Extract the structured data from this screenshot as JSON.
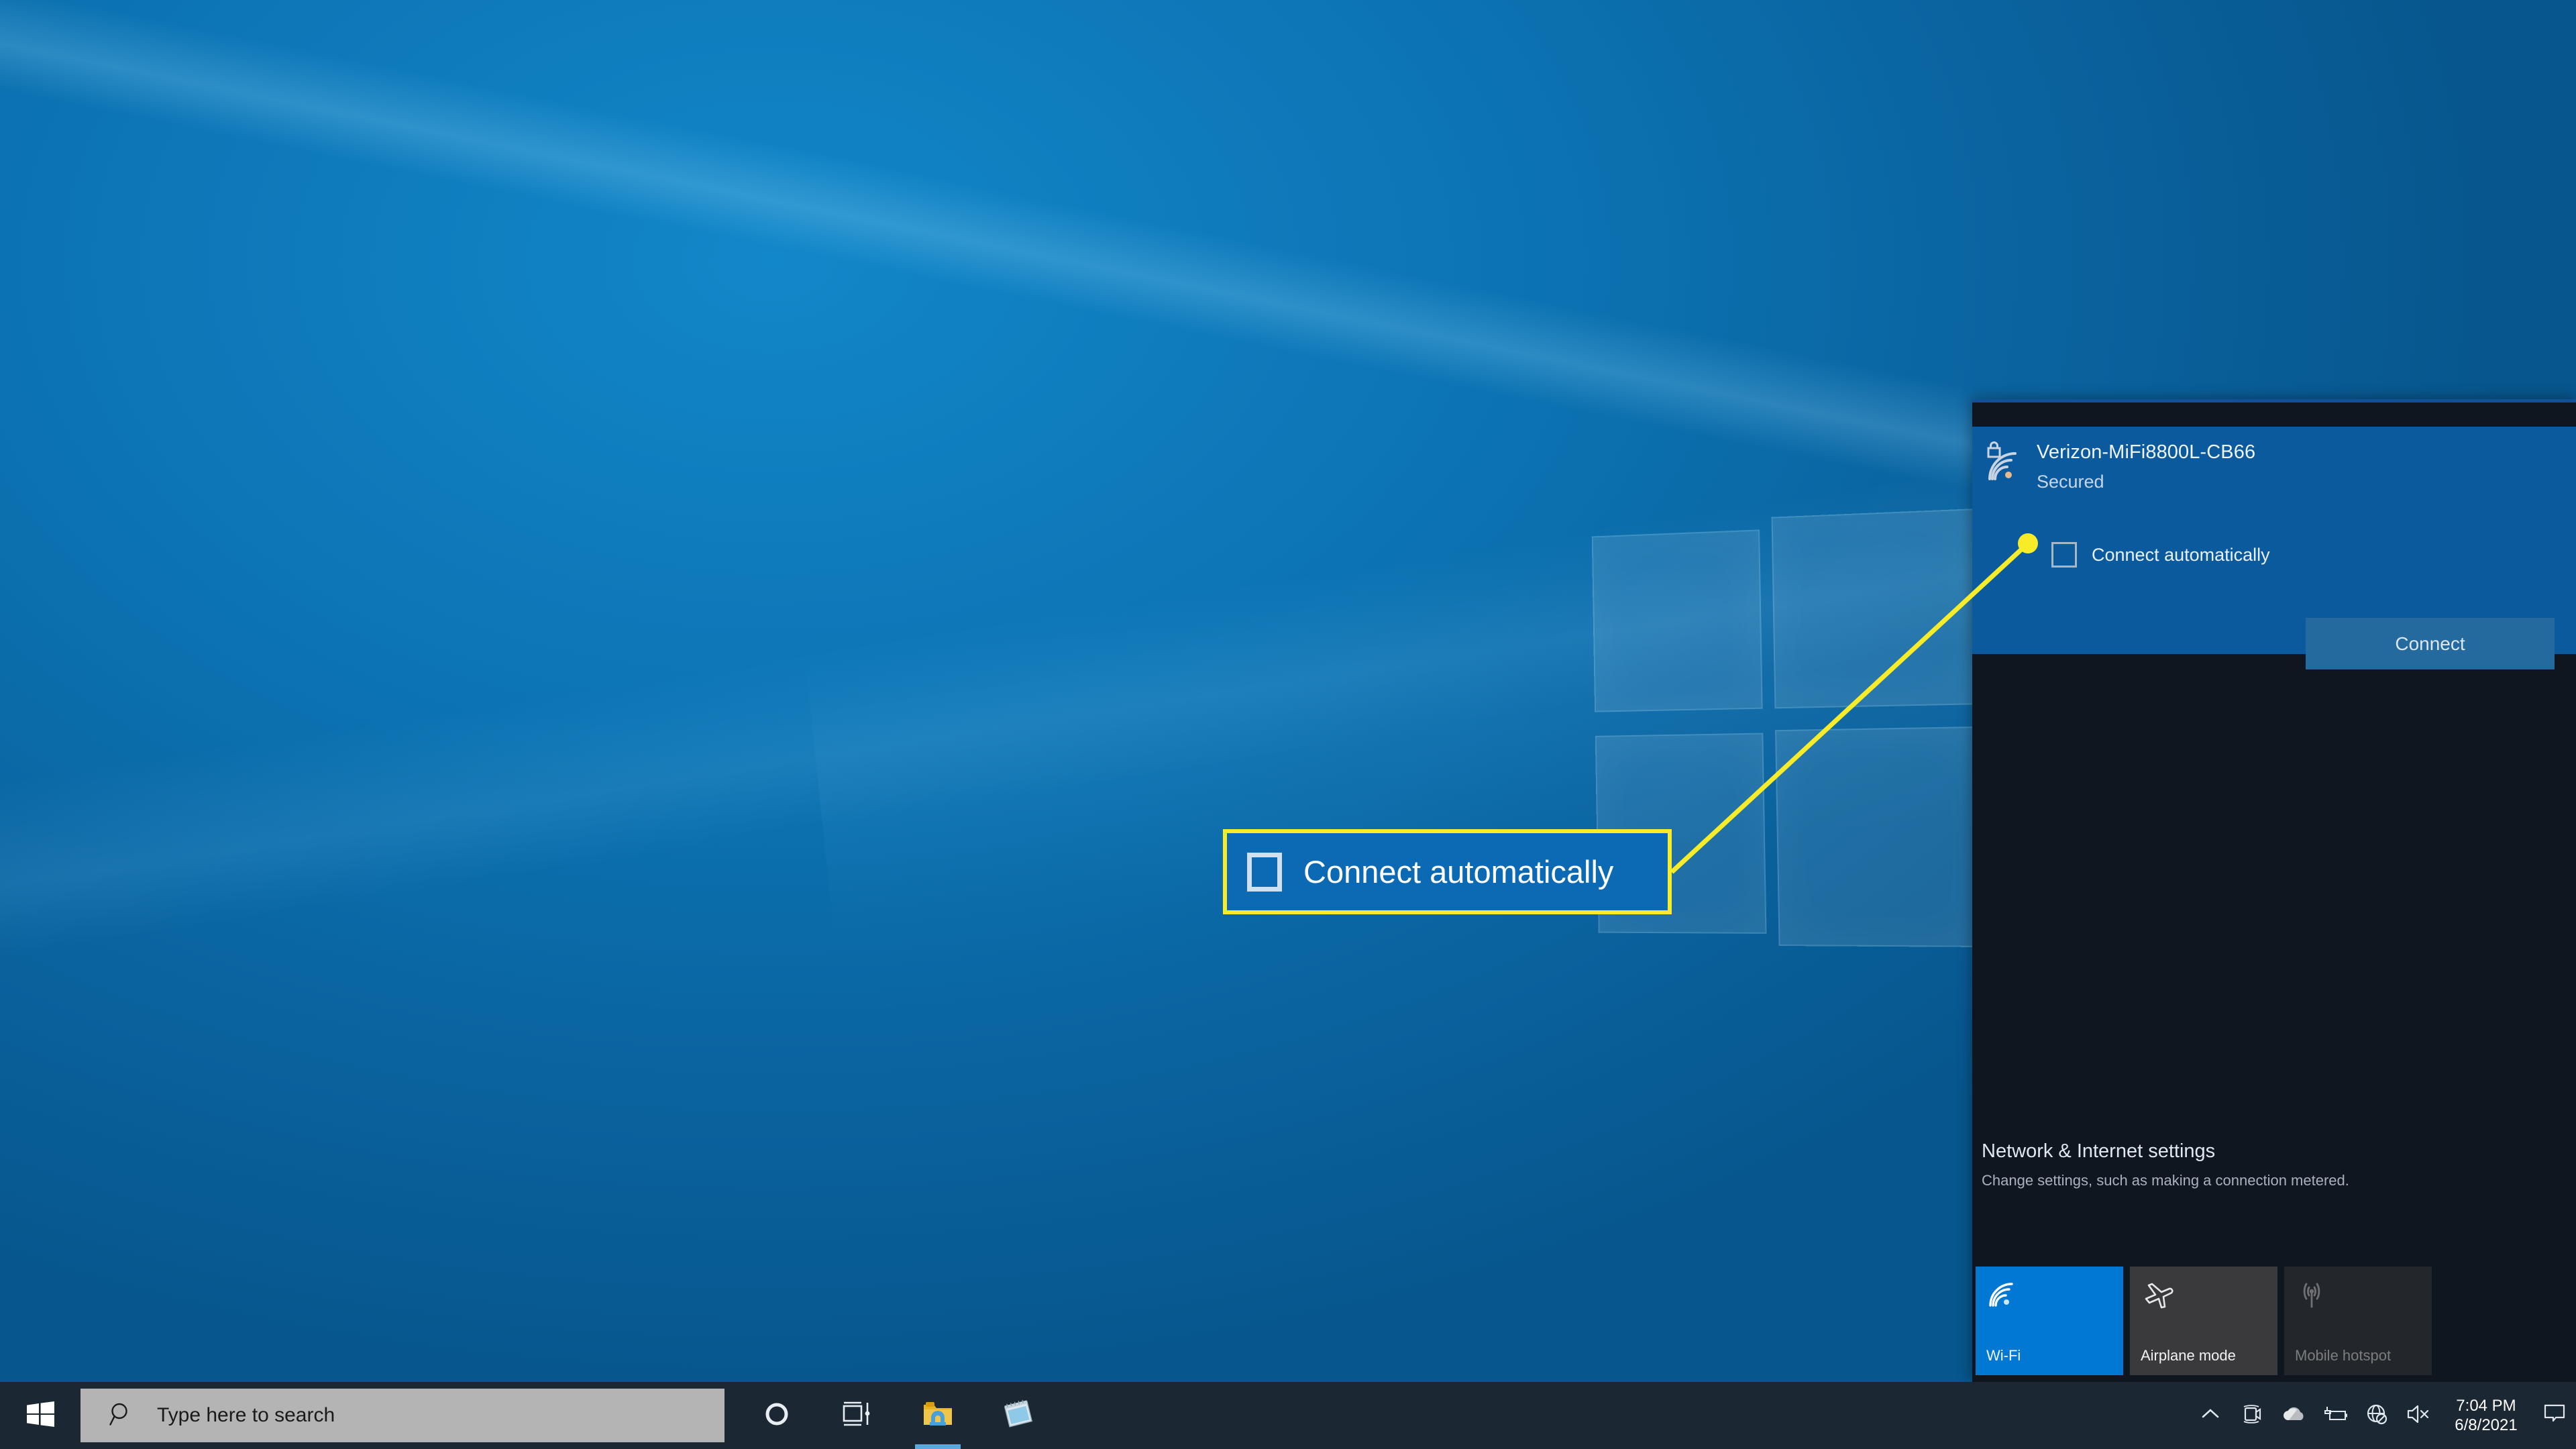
{
  "desktop": {
    "wallpaper_icon": "windows-logo",
    "colors": {
      "wallpaper_blue": "#0c74b4",
      "accent": "#0078d4"
    }
  },
  "network_panel": {
    "selected_network": {
      "ssid": "Verizon-MiFi8800L-CB66",
      "security_status": "Secured",
      "icon": "wifi-secured-icon",
      "connect_automatically_label": "Connect automatically",
      "connect_automatically_checked": false,
      "connect_button_label": "Connect"
    },
    "settings": {
      "title": "Network & Internet settings",
      "subtitle": "Change settings, such as making a connection metered."
    },
    "quick_tiles": [
      {
        "label": "Wi-Fi",
        "icon": "wifi-icon",
        "state": "on"
      },
      {
        "label": "Airplane mode",
        "icon": "airplane-icon",
        "state": "off"
      },
      {
        "label": "Mobile hotspot",
        "icon": "hotspot-icon",
        "state": "disabled"
      }
    ]
  },
  "annotation": {
    "checkbox_label": "Connect automatically",
    "highlight_color": "#f7ec27"
  },
  "taskbar": {
    "start_icon": "windows-start-icon",
    "search": {
      "placeholder": "Type here to search",
      "icon": "search-icon"
    },
    "pinned": [
      {
        "name": "cortana-icon",
        "label": "Cortana"
      },
      {
        "name": "task-view-icon",
        "label": "Task View"
      },
      {
        "name": "file-explorer-icon",
        "label": "File Explorer"
      },
      {
        "name": "sticky-notes-icon",
        "label": "Sticky Notes"
      }
    ],
    "tray": [
      {
        "name": "show-hidden-icons-icon"
      },
      {
        "name": "camera-icon"
      },
      {
        "name": "onedrive-icon"
      },
      {
        "name": "battery-charging-icon"
      },
      {
        "name": "network-no-internet-icon"
      },
      {
        "name": "volume-muted-icon"
      }
    ],
    "clock": {
      "time": "7:04 PM",
      "date": "6/8/2021"
    },
    "action_center_icon": "action-center-icon"
  }
}
